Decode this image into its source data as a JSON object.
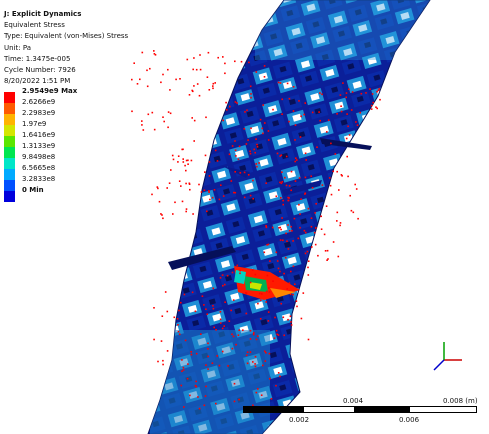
{
  "header": {
    "title": "J: Explicit Dynamics",
    "result": "Equivalent Stress",
    "type": "Type: Equivalent (von-Mises) Stress",
    "unit": "Unit: Pa",
    "time": "Time: 1.3475e-005",
    "cycle": "Cycle Number: 7926",
    "date": "8/20/2022 1:51 PM"
  },
  "legend": {
    "entries": [
      {
        "label": "2.9549e9 Max",
        "color": "#ff0000",
        "bold": true
      },
      {
        "label": "2.6266e9",
        "color": "#ff5a00",
        "bold": false
      },
      {
        "label": "2.2983e9",
        "color": "#ffb400",
        "bold": false
      },
      {
        "label": "1.97e9",
        "color": "#d4e600",
        "bold": false
      },
      {
        "label": "1.6416e9",
        "color": "#5ae600",
        "bold": false
      },
      {
        "label": "1.3133e9",
        "color": "#00e650",
        "bold": false
      },
      {
        "label": "9.8498e8",
        "color": "#00e6c8",
        "bold": false
      },
      {
        "label": "6.5665e8",
        "color": "#00aaff",
        "bold": false
      },
      {
        "label": "3.2833e8",
        "color": "#0050ff",
        "bold": false
      },
      {
        "label": "0 Min",
        "color": "#0000dc",
        "bold": true
      }
    ]
  },
  "scale_bar": {
    "labels_top": [
      "0.004",
      "0.008 (m)"
    ],
    "labels_bottom": [
      "0.002",
      "0.006"
    ]
  },
  "colors": {
    "mesh_blue": "#1a90d8",
    "mesh_dark": "#0a1a8c",
    "mesh_deep": "#06105a",
    "particles": "#ff0000"
  }
}
